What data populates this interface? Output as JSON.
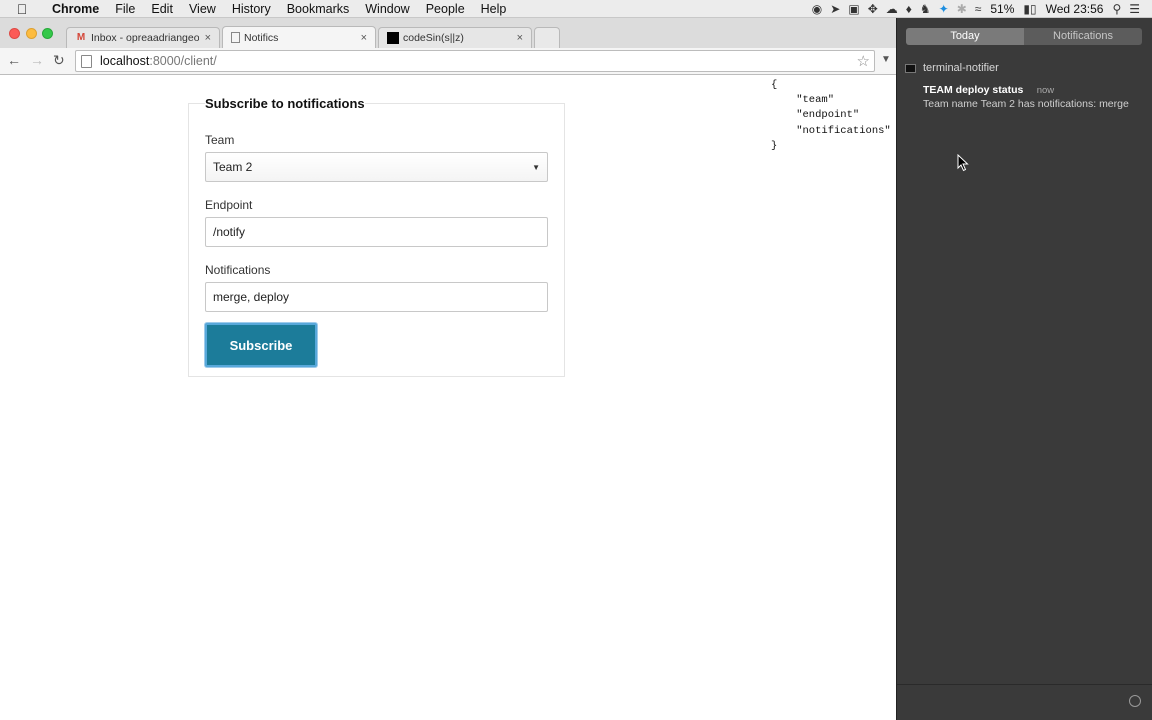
{
  "menubar": {
    "app": "Chrome",
    "items": [
      "File",
      "Edit",
      "View",
      "History",
      "Bookmarks",
      "Window",
      "People",
      "Help"
    ],
    "battery": "51%",
    "clock": "Wed 23:56"
  },
  "tabs": [
    {
      "title": "Inbox - opreaadriangeorge",
      "favicon": "gmail-icon",
      "close": "×"
    },
    {
      "title": "Notifics",
      "favicon": "page-icon",
      "close": "×"
    },
    {
      "title": "codeSin(s||z)",
      "favicon": "black-square-icon",
      "close": "×"
    }
  ],
  "address": {
    "host": "localhost",
    "path": ":8000/client/"
  },
  "form": {
    "legend": "Subscribe to notifications",
    "team_label": "Team",
    "team_value": "Team 2",
    "endpoint_label": "Endpoint",
    "endpoint_value": "/notify",
    "notifications_label": "Notifications",
    "notifications_value": "merge, deploy",
    "submit_label": "Subscribe"
  },
  "json_output": "{\n    \"team\"\n    \"endpoint\"\n    \"notifications\"\n}",
  "notification_center": {
    "tab_today": "Today",
    "tab_notifications": "Notifications",
    "app_name": "terminal-notifier",
    "note_title": "TEAM deploy status",
    "note_time": "now",
    "note_body": "Team name Team 2 has notifications: merge"
  },
  "colors": {
    "accent": "#1c7c9a",
    "nc_bg": "#3a3a3a"
  }
}
